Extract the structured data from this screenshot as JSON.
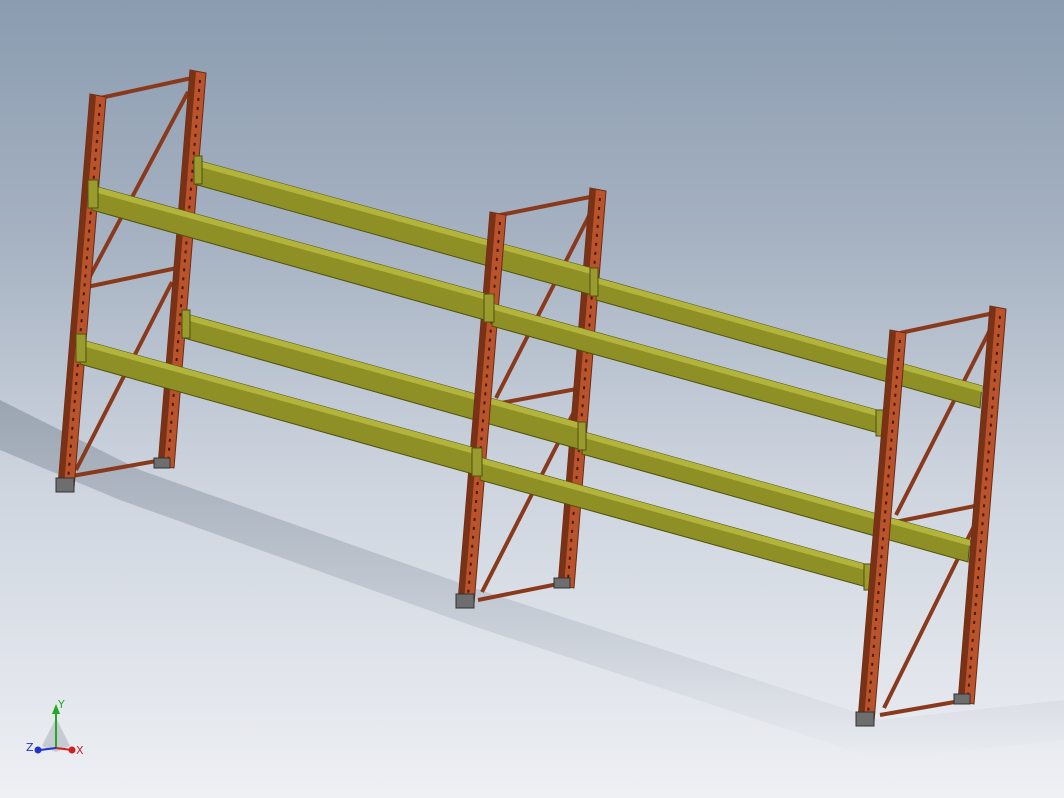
{
  "viewport": {
    "background_top": "#8b9cb0",
    "background_bottom": "#eef0f4"
  },
  "model": {
    "upright_color": "#b8532c",
    "upright_dark": "#6b2a12",
    "brace_color": "#8a3a1c",
    "beam_color": "#8e8f24",
    "beam_dark": "#50520f",
    "beam_light": "#b3b43c",
    "shadow_color": "#9aa3ae"
  },
  "triad": {
    "x_label": "X",
    "y_label": "Y",
    "z_label": "Z",
    "x_color": "#cc2222",
    "y_color": "#22aa22",
    "z_color": "#2233cc"
  }
}
